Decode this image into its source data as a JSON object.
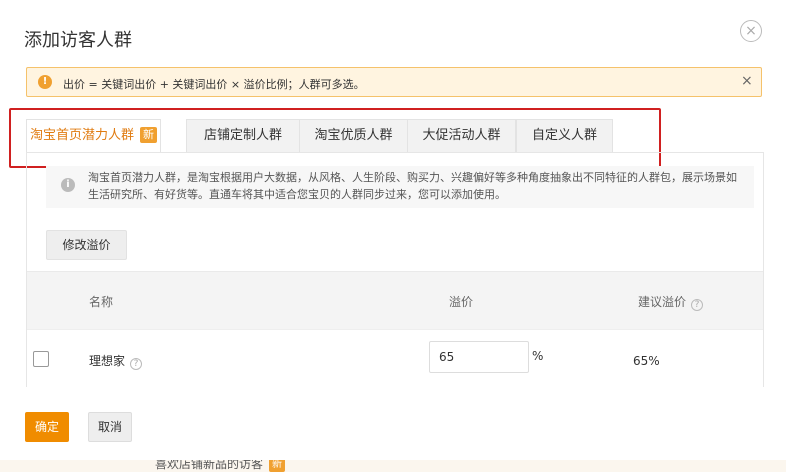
{
  "dialog": {
    "title": "添加访客人群",
    "close_glyph": "×"
  },
  "notice": {
    "icon_glyph": "!",
    "text": "出价 = 关键词出价 + 关键词出价 × 溢价比例；人群可多选。",
    "close_glyph": "×"
  },
  "tabs": [
    {
      "label": "淘宝首页潜力人群",
      "badge": "新",
      "active": true
    },
    {
      "label": "店铺定制人群"
    },
    {
      "label": "淘宝优质人群"
    },
    {
      "label": "大促活动人群"
    },
    {
      "label": "自定义人群"
    }
  ],
  "info": {
    "icon_glyph": "i",
    "text": "淘宝首页潜力人群，是淘宝根据用户大数据，从风格、人生阶段、购买力、兴趣偏好等多种角度抽象出不同特征的人群包，展示场景如生活研究所、有好货等。直通车将其中适合您宝贝的人群同步过来，您可以添加使用。"
  },
  "actions": {
    "modify_label": "修改溢价"
  },
  "table": {
    "headers": {
      "name": "名称",
      "premium": "溢价",
      "suggested": "建议溢价"
    },
    "help_glyph": "?",
    "rows": [
      {
        "name": "理想家",
        "premium_value": "65",
        "unit": "%",
        "suggested": "65%"
      }
    ]
  },
  "footer": {
    "confirm_label": "确定",
    "cancel_label": "取消"
  },
  "background": {
    "peek_text": "喜欢店铺新品的访客",
    "badge": "新"
  },
  "colors": {
    "accent": "#f08c00",
    "warning_bg": "#fff4e0",
    "highlight_frame": "#d02020"
  }
}
